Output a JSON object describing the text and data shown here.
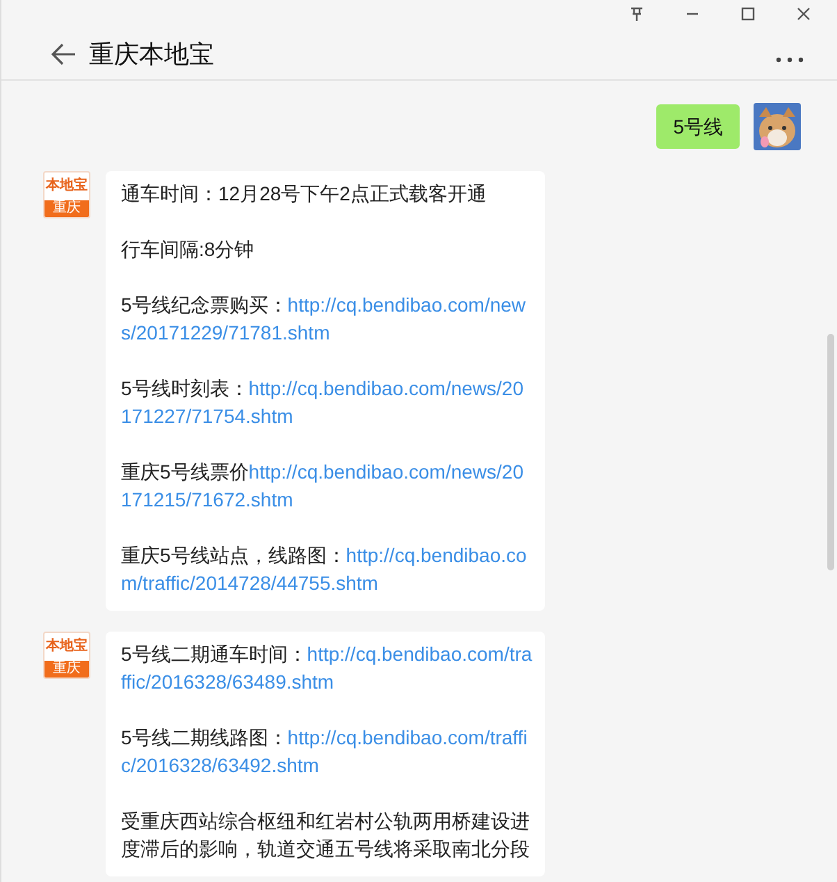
{
  "window": {
    "title": "重庆本地宝"
  },
  "messages": [
    {
      "kind": "outgoing",
      "text": "5号线"
    },
    {
      "kind": "incoming",
      "avatar": {
        "top": "本地宝",
        "bottom": "重庆"
      },
      "paragraphs": [
        {
          "text": "通车时间：12月28号下午2点正式载客开通"
        },
        {
          "text": "行车间隔:8分钟"
        },
        {
          "text": "5号线纪念票购买：",
          "link": "http://cq.bendibao.com/news/20171229/71781.shtm"
        },
        {
          "text": "5号线时刻表：",
          "link": "http://cq.bendibao.com/news/20171227/71754.shtm"
        },
        {
          "text": "重庆5号线票价",
          "link": "http://cq.bendibao.com/news/20171215/71672.shtm"
        },
        {
          "text": "重庆5号线站点，线路图：",
          "link": "http://cq.bendibao.com/traffic/2014728/44755.shtm"
        }
      ]
    },
    {
      "kind": "incoming",
      "avatar": {
        "top": "本地宝",
        "bottom": "重庆"
      },
      "paragraphs": [
        {
          "text": "5号线二期通车时间：",
          "link": "http://cq.bendibao.com/traffic/2016328/63489.shtm"
        },
        {
          "text": "5号线二期线路图：",
          "link": "http://cq.bendibao.com/traffic/2016328/63492.shtm"
        },
        {
          "text": "受重庆西站综合枢纽和红岩村公轨两用桥建设进度滞后的影响，轨道交通五号线将采取南北分段"
        }
      ]
    }
  ]
}
